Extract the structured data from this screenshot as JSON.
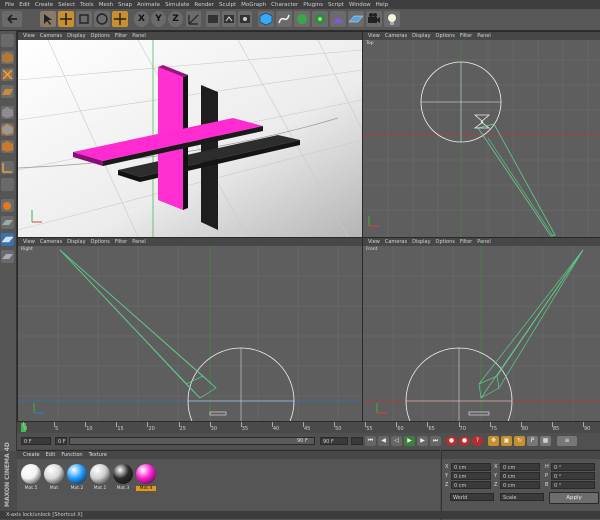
{
  "menu": [
    "File",
    "Edit",
    "Create",
    "Select",
    "Tools",
    "Mesh",
    "Snap",
    "Animate",
    "Simulate",
    "Render",
    "Sculpt",
    "MoGraph",
    "Character",
    "Plugins",
    "Script",
    "Window",
    "Help"
  ],
  "toolbar": {
    "axis_x": "X",
    "axis_y": "Y",
    "axis_z": "Z"
  },
  "viewport_menu": [
    "View",
    "Cameras",
    "Display",
    "Options",
    "Filter",
    "Panel"
  ],
  "viewports": {
    "perspective": {
      "label": ""
    },
    "top": {
      "label": "Top"
    },
    "right": {
      "label": "Right"
    },
    "front": {
      "label": "Front"
    }
  },
  "timeline": {
    "ticks": [
      "0",
      "5",
      "10",
      "15",
      "20",
      "25",
      "30",
      "35",
      "40",
      "45",
      "50",
      "55",
      "60",
      "65",
      "70",
      "75",
      "80",
      "85",
      "90"
    ],
    "current_frame": "0 F"
  },
  "transport": {
    "start_field": "0 F",
    "current_field": "0 F",
    "end_field": "90 F",
    "end_field2": "90 F",
    "slider_value": "90 F"
  },
  "materials": {
    "menu": [
      "Create",
      "Edit",
      "Function",
      "Texture"
    ],
    "items": [
      {
        "name": "Mat.5",
        "color": "#f2f2f2"
      },
      {
        "name": "Mat",
        "color": "#d8d8d8"
      },
      {
        "name": "Mat.2",
        "color": "#1e9bff"
      },
      {
        "name": "Mat.1",
        "color": "#cfcfcf"
      },
      {
        "name": "Mat.3",
        "color": "#2a2a2a"
      },
      {
        "name": "Mat.4",
        "color": "#ff1bd0"
      }
    ]
  },
  "coords": {
    "rows": [
      {
        "axis": "X",
        "pos": "0 cm",
        "axis2": "X",
        "size": "0 cm",
        "axis3": "H",
        "rot": "0 °"
      },
      {
        "axis": "Y",
        "pos": "0 cm",
        "axis2": "Y",
        "size": "0 cm",
        "axis3": "P",
        "rot": "0 °"
      },
      {
        "axis": "Z",
        "pos": "0 cm",
        "axis2": "Z",
        "size": "0 cm",
        "axis3": "B",
        "rot": "0 °"
      }
    ],
    "mode": "World",
    "scale": "Scale",
    "apply": "Apply"
  },
  "status": "X-axis lock/unlock [Shortcut X]",
  "brand": "MAXON CINEMA 4D"
}
